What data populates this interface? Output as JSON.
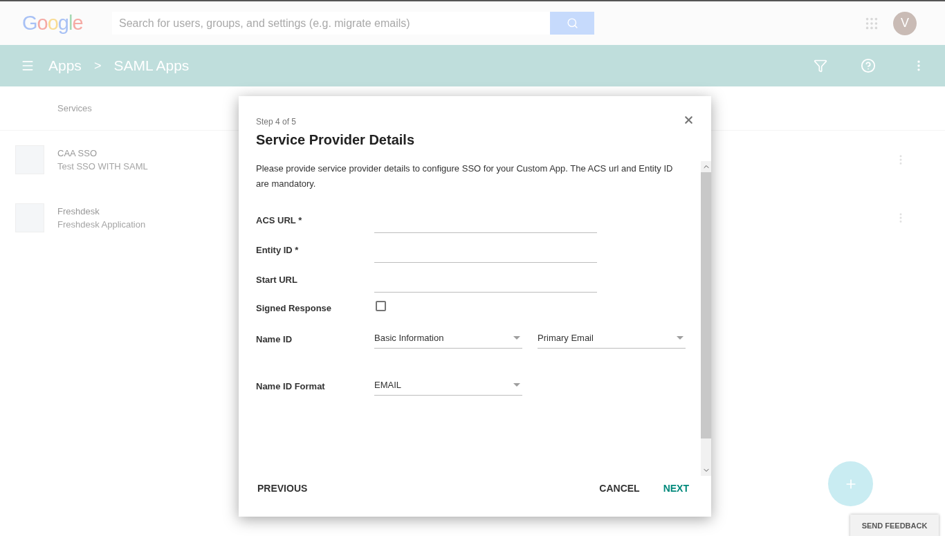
{
  "header": {
    "logo": "Google",
    "search": {
      "placeholder": "Search for users, groups, and settings (e.g. migrate emails)"
    },
    "avatar": "V"
  },
  "toolbar": {
    "breadcrumb": [
      "Apps",
      "SAML Apps"
    ],
    "separator": ">"
  },
  "list": {
    "heading": "Services",
    "apps": [
      {
        "name": "CAA SSO",
        "description": "Test SSO WITH SAML"
      },
      {
        "name": "Freshdesk",
        "description": "Freshdesk Application"
      }
    ]
  },
  "dialog": {
    "step": "Step 4 of 5",
    "title": "Service Provider Details",
    "description": "Please provide service provider details to configure SSO for your Custom App. The ACS url and Entity ID are mandatory.",
    "fields": [
      {
        "kind": "text",
        "label": "ACS URL *"
      },
      {
        "kind": "text",
        "label": "Entity ID *"
      },
      {
        "kind": "text",
        "label": "Start URL"
      },
      {
        "kind": "checkbox",
        "label": "Signed Response",
        "checked": false
      },
      {
        "kind": "select",
        "label": "Name ID",
        "values": [
          "Basic Information",
          "Primary Email"
        ]
      },
      {
        "kind": "select",
        "label": "Name ID Format",
        "values": [
          "EMAIL"
        ]
      }
    ],
    "buttons": {
      "previous": "PREVIOUS",
      "cancel": "CANCEL",
      "next": "NEXT"
    }
  },
  "feedback": "SEND FEEDBACK"
}
